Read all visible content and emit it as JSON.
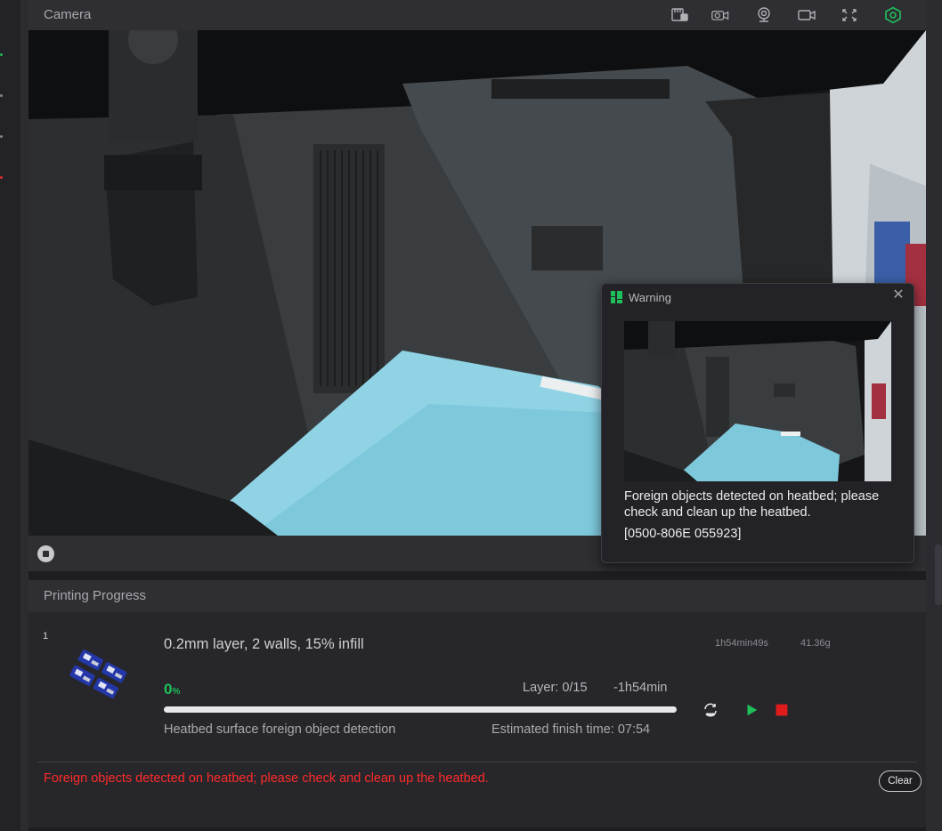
{
  "camera": {
    "title": "Camera",
    "icons": [
      "sd-card-icon",
      "camera-settings-icon",
      "webcam-icon",
      "video-record-icon",
      "fullscreen-icon",
      "gear-icon"
    ],
    "accent": "#1fbf5a"
  },
  "warning": {
    "title": "Warning",
    "message": "Foreign objects detected on heatbed; please check and clean up the heatbed.",
    "code": "[0500-806E 055923]"
  },
  "progress": {
    "title": "Printing Progress",
    "plate_number": "1",
    "job_name": "0.2mm layer, 2 walls, 15% infill",
    "total_time": "1h54min49s",
    "weight": "41.36g",
    "percent": "0",
    "percent_symbol": "%",
    "percent_value": 0,
    "layer": "Layer: 0/15",
    "remaining": "-1h54min",
    "stage": "Heatbed surface foreign object detection",
    "finish_time": "Estimated finish time: 07:54",
    "error_message": "Foreign objects detected on heatbed; please check and clean up the heatbed.",
    "clear_label": "Clear",
    "colors": {
      "progress": "#1fbf5a",
      "error": "#ff2a2a",
      "stop": "#e01b1b"
    }
  }
}
